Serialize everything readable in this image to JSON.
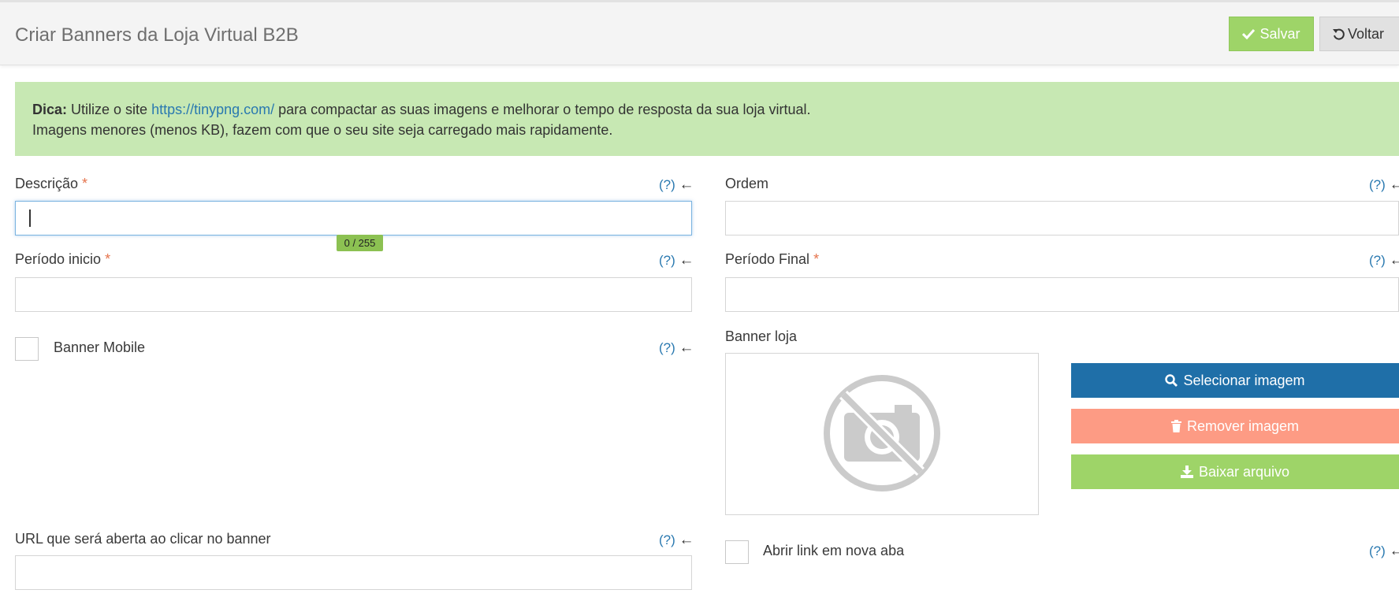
{
  "header": {
    "title": "Criar Banners da Loja Virtual B2B",
    "save_label": "Salvar",
    "back_label": "Voltar"
  },
  "alert": {
    "bold": "Dica:",
    "text_before_link": " Utilize o site ",
    "link": "https://tinypng.com/",
    "text_after_link": " para compactar as suas imagens e melhorar o tempo de resposta da sua loja virtual.",
    "line2": "Imagens menores (menos KB), fazem com que o seu site seja carregado mais rapidamente."
  },
  "help_text": "(?)",
  "arrow": "←",
  "required_mark": "*",
  "fields": {
    "descricao": {
      "label": "Descrição",
      "value": "",
      "counter": "0 / 255"
    },
    "ordem": {
      "label": "Ordem",
      "value": ""
    },
    "periodo_inicio": {
      "label": "Período inicio",
      "value": ""
    },
    "periodo_final": {
      "label": "Período Final",
      "value": ""
    },
    "banner_mobile": {
      "label": "Banner Mobile"
    },
    "banner_loja": {
      "label": "Banner loja"
    },
    "url": {
      "label": "URL que será aberta ao clicar no banner",
      "value": ""
    },
    "nova_aba": {
      "label": "Abrir link em nova aba"
    }
  },
  "image_buttons": {
    "select": "Selecionar imagem",
    "remove": "Remover imagem",
    "download": "Baixar arquivo"
  },
  "icons": {
    "save": "check-icon",
    "back": "undo-icon",
    "select": "search-icon",
    "remove": "trash-icon",
    "download": "download-icon",
    "placeholder": "no-photo-icon"
  },
  "colors": {
    "save_green": "#9ed468",
    "alert_green": "#c7e8b3",
    "primary_blue": "#1f6fa8",
    "danger_salmon": "#fd9b84",
    "required_orange": "#e5734c",
    "link_blue": "#2a79b0"
  }
}
